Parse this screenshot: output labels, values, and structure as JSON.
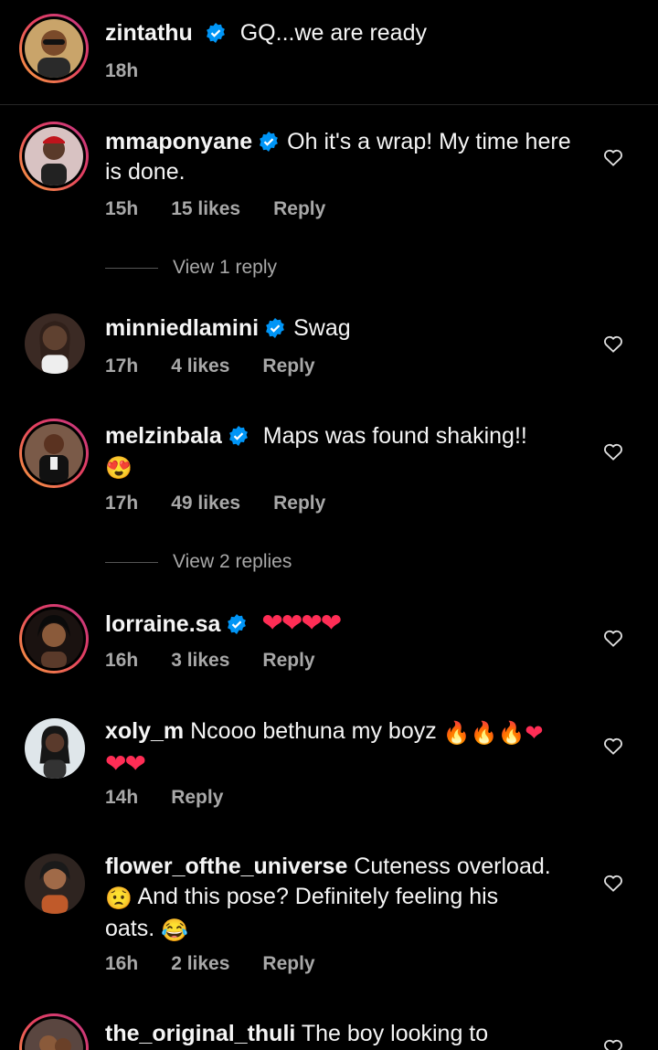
{
  "caption": {
    "username": "zintathu",
    "text": "GQ...we are ready",
    "time": "18h"
  },
  "comments": [
    {
      "username": "mmaponyane",
      "text": "Oh it's a wrap! My time here is done.",
      "time": "15h",
      "likes": "15 likes",
      "reply": "Reply",
      "view_replies": "View 1 reply"
    },
    {
      "username": "minniedlamini",
      "text": "Swag",
      "time": "17h",
      "likes": "4 likes",
      "reply": "Reply"
    },
    {
      "username": "melzinbala",
      "text": "Maps was found shaking!!",
      "emoji": "😍",
      "time": "17h",
      "likes": "49 likes",
      "reply": "Reply",
      "view_replies": "View 2 replies"
    },
    {
      "username": "lorraine.sa",
      "text": "❤❤❤❤",
      "time": "16h",
      "likes": "3 likes",
      "reply": "Reply"
    },
    {
      "username": "xoly_m",
      "text": "Ncooo bethuna my boyz",
      "emoji_line1": "🔥🔥🔥❤",
      "emoji_line2": "❤❤",
      "time": "14h",
      "reply": "Reply"
    },
    {
      "username": "flower_ofthe_universe",
      "text1": "Cuteness overload.",
      "emoji_a": "😟",
      "text2": "And this pose? Definitely feeling his",
      "text3": "oats.",
      "emoji_b": "😂",
      "time": "16h",
      "likes": "2 likes",
      "reply": "Reply"
    },
    {
      "username": "the_original_thuli",
      "text": "The boy looking to"
    }
  ],
  "colors": {
    "verified": "#0095f6",
    "background": "#000000",
    "muted": "#a8a8a8"
  }
}
